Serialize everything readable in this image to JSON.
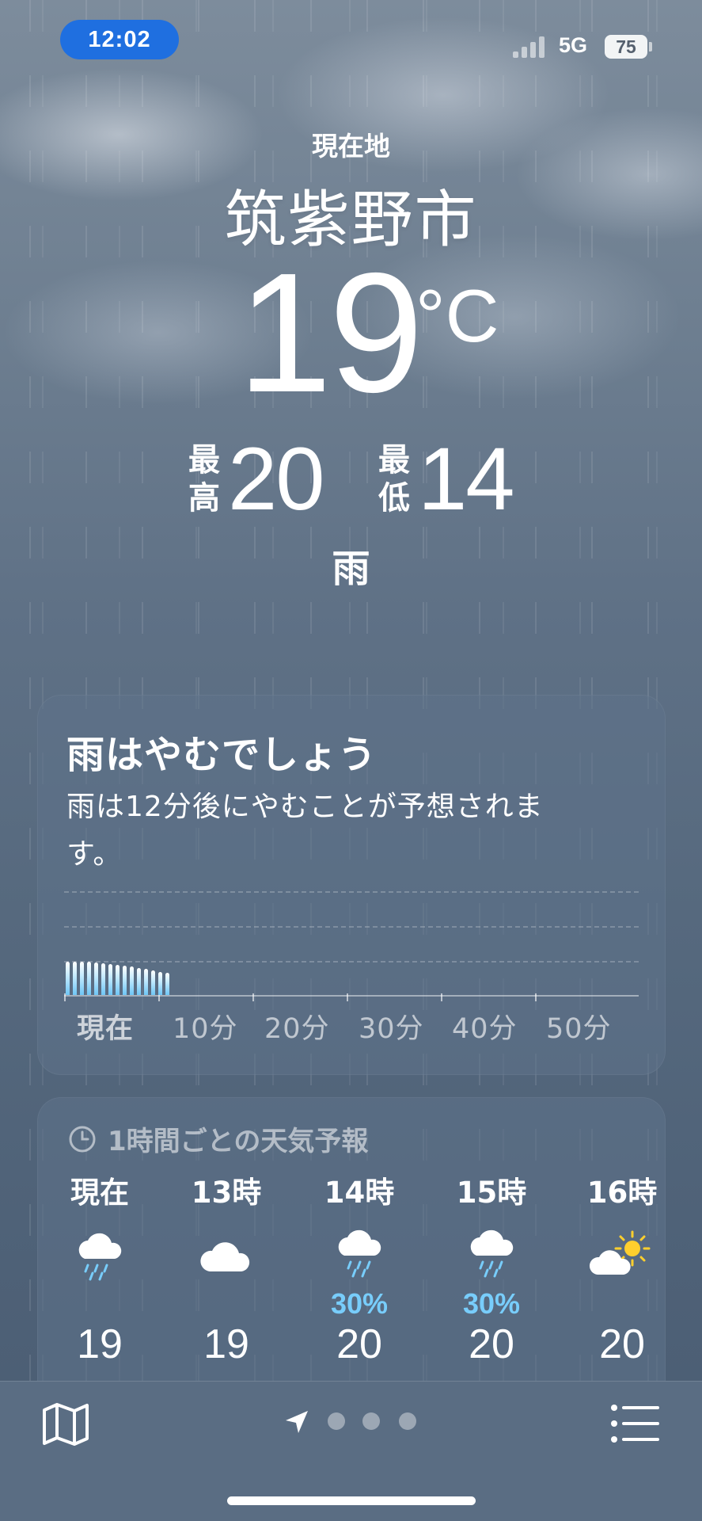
{
  "status_bar": {
    "time": "12:02",
    "network": "5G",
    "battery": "75"
  },
  "header": {
    "location_label": "現在地",
    "city": "筑紫野市",
    "temperature": "19",
    "unit": "°C",
    "high_label_1": "最",
    "high_label_2": "高",
    "high": "20",
    "low_label_1": "最",
    "low_label_2": "低",
    "low": "14",
    "condition": "雨"
  },
  "precip_card": {
    "title": "雨はやむでしょう",
    "description": "雨は12分後にやむことが予想されます。",
    "time_labels": [
      "現在",
      "10分",
      "20分",
      "30分",
      "40分",
      "50分"
    ],
    "intensity": [
      1.0,
      1.0,
      1.0,
      1.0,
      0.98,
      0.96,
      0.93,
      0.9,
      0.88,
      0.85,
      0.82,
      0.78,
      0.74,
      0.7,
      0.66
    ]
  },
  "hourly_card": {
    "title": "1時間ごとの天気予報",
    "hours": [
      {
        "label": "現在",
        "icon": "cloud-rain-icon",
        "pop": "",
        "temp": "19"
      },
      {
        "label": "13時",
        "icon": "cloud-icon",
        "pop": "",
        "temp": "19"
      },
      {
        "label": "14時",
        "icon": "cloud-rain-icon",
        "pop": "30%",
        "temp": "20"
      },
      {
        "label": "15時",
        "icon": "cloud-rain-icon",
        "pop": "30%",
        "temp": "20"
      },
      {
        "label": "16時",
        "icon": "partly-sunny-icon",
        "pop": "",
        "temp": "20"
      }
    ]
  },
  "colors": {
    "accent_precip": "#78cdfb",
    "time_pill": "#1f6fe0"
  },
  "bottom_bar": {
    "icons": [
      "map-icon",
      "location-arrow-icon",
      "list-icon"
    ],
    "page_count": 3
  }
}
